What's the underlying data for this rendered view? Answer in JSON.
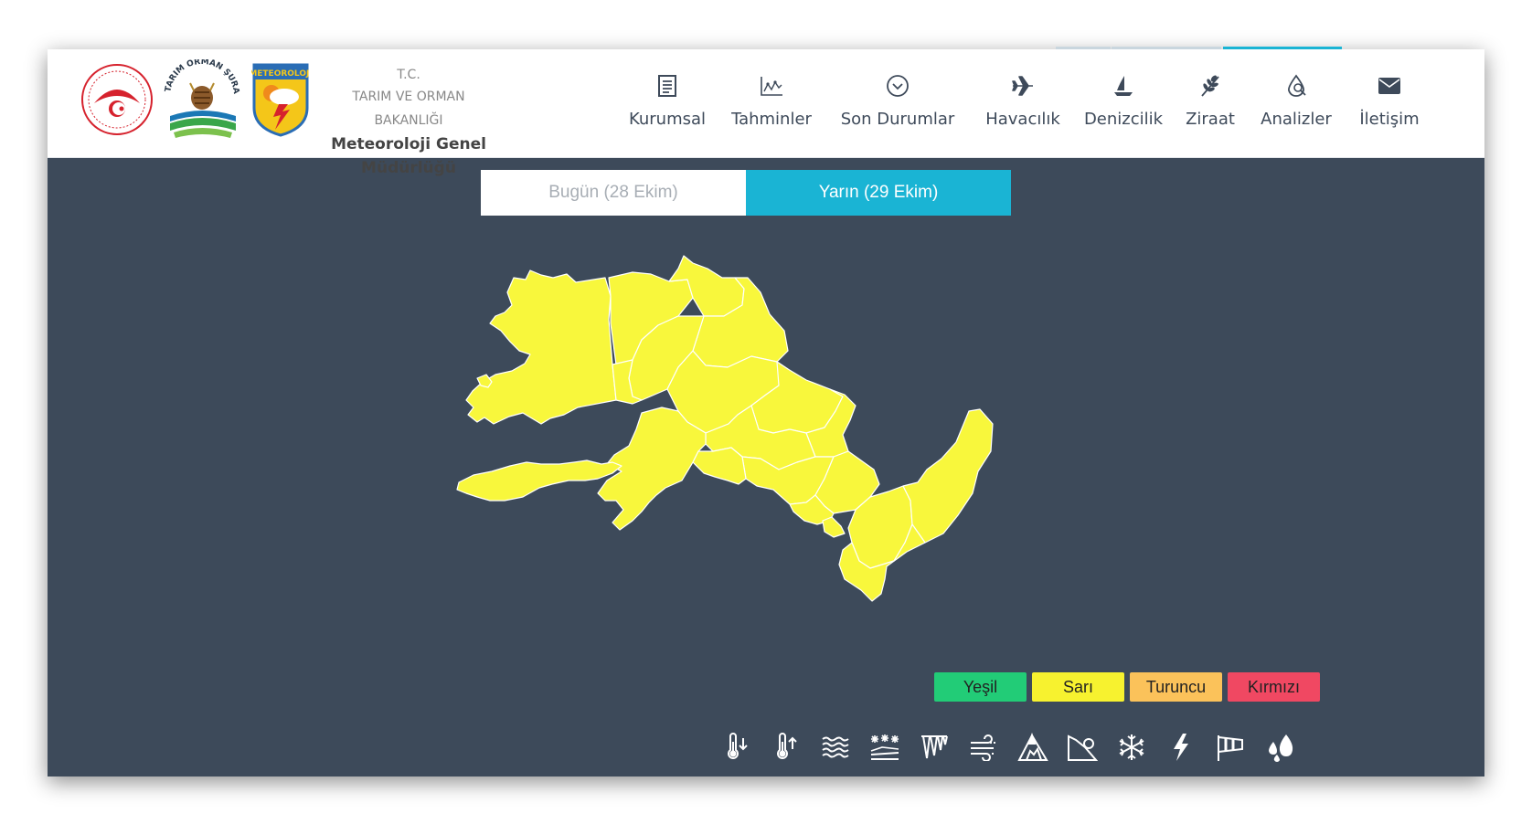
{
  "header": {
    "ministry_line1": "T.C.",
    "ministry_line2": "TARIM VE ORMAN BAKANLIĞI",
    "ministry_line3": "Meteoroloji Genel Müdürlüğü",
    "logo_shura_text": "TARIM ORMAN ŞURASI",
    "logo_mgm_text": "METEOROLOJİ"
  },
  "nav": [
    {
      "label": "Kurumsal",
      "icon": "document-icon"
    },
    {
      "label": "Tahminler",
      "icon": "chart-icon"
    },
    {
      "label": "Son Durumlar",
      "icon": "chevron-circle-icon"
    },
    {
      "label": "Havacılık",
      "icon": "plane-icon"
    },
    {
      "label": "Denizcilik",
      "icon": "sailboat-icon"
    },
    {
      "label": "Ziraat",
      "icon": "wheat-icon"
    },
    {
      "label": "Analizler",
      "icon": "analysis-icon"
    },
    {
      "label": "İletişim",
      "icon": "envelope-icon"
    }
  ],
  "tabs": {
    "today": "Bugün (28 Ekim)",
    "tomorrow": "Yarın (29 Ekim)",
    "active": "tomorrow"
  },
  "map": {
    "region_fill": "#f8f73c",
    "region_stroke": "#ffffff"
  },
  "legend": [
    {
      "label": "Yeşil",
      "color": "#22cc77"
    },
    {
      "label": "Sarı",
      "color": "#f7f22f"
    },
    {
      "label": "Turuncu",
      "color": "#fbc25a"
    },
    {
      "label": "Kırmızı",
      "color": "#f04862"
    }
  ],
  "hazards": [
    "cold-temperature-icon",
    "hot-temperature-icon",
    "fog-icon",
    "snow-ice-icon",
    "icing-icon",
    "wind-icon",
    "avalanche-icon",
    "landslide-icon",
    "snow-icon",
    "thunderstorm-icon",
    "strong-wind-icon",
    "rain-icon"
  ],
  "colors": {
    "accent": "#1ab4d4",
    "background": "#3d4a5a",
    "nav_text": "#3e4a5a"
  }
}
